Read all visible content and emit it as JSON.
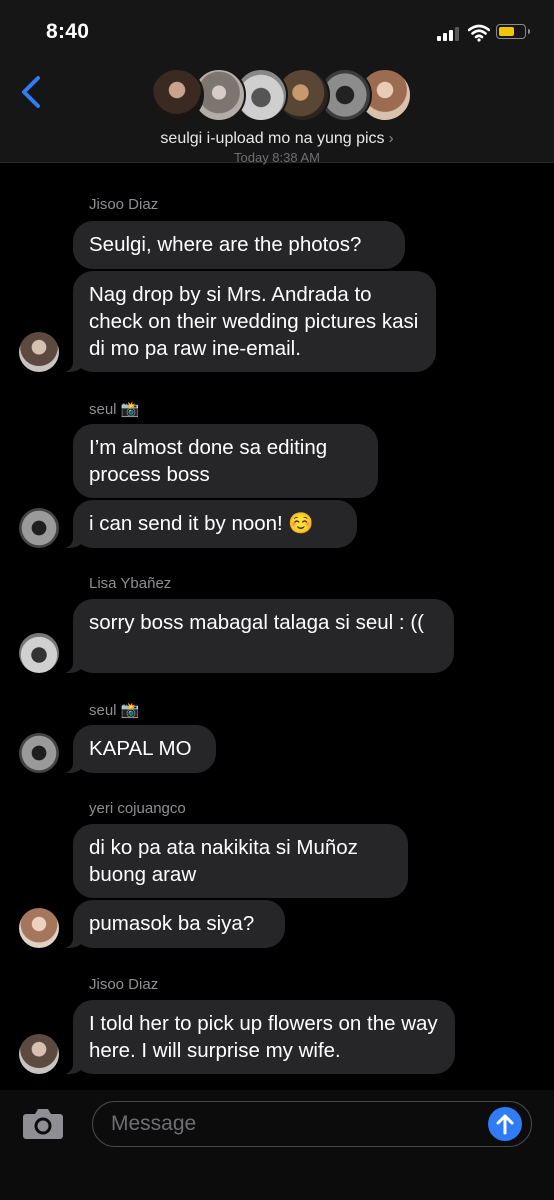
{
  "status_bar": {
    "time": "8:40"
  },
  "header": {
    "group_name": "seulgi i-upload mo na yung pics",
    "timestamp_peek": "Today 8:38 AM",
    "chevron": "›"
  },
  "colors": {
    "bubble": "#262629",
    "accent": "#2f7cf6",
    "battery": "#f5c400"
  },
  "messages": [
    {
      "sender": "Jisoo Diaz",
      "bubbles": [
        "Seulgi, where are the photos?",
        "Nag drop by si Mrs. Andrada to check on their wedding pictures kasi di mo pa raw ine-email."
      ]
    },
    {
      "sender": "seul 📸",
      "bubbles": [
        "I’m almost done sa editing process boss",
        "i can send it by noon! ☺️"
      ]
    },
    {
      "sender": "Lisa Ybañez",
      "bubbles": [
        "sorry boss mabagal talaga si seul : (("
      ]
    },
    {
      "sender": "seul 📸",
      "bubbles": [
        "KAPAL MO"
      ]
    },
    {
      "sender": "yeri cojuangco",
      "bubbles": [
        "di ko pa ata nakikita si Muñoz buong araw",
        "pumasok ba siya?"
      ]
    },
    {
      "sender": "Jisoo Diaz",
      "bubbles": [
        "I told her to pick up flowers on the way here. I will surprise my wife."
      ]
    }
  ],
  "composer": {
    "placeholder": "Message"
  },
  "icons": [
    "back-chevron-icon",
    "camera-icon",
    "send-arrow-icon",
    "signal-icon",
    "wifi-icon",
    "battery-icon"
  ]
}
